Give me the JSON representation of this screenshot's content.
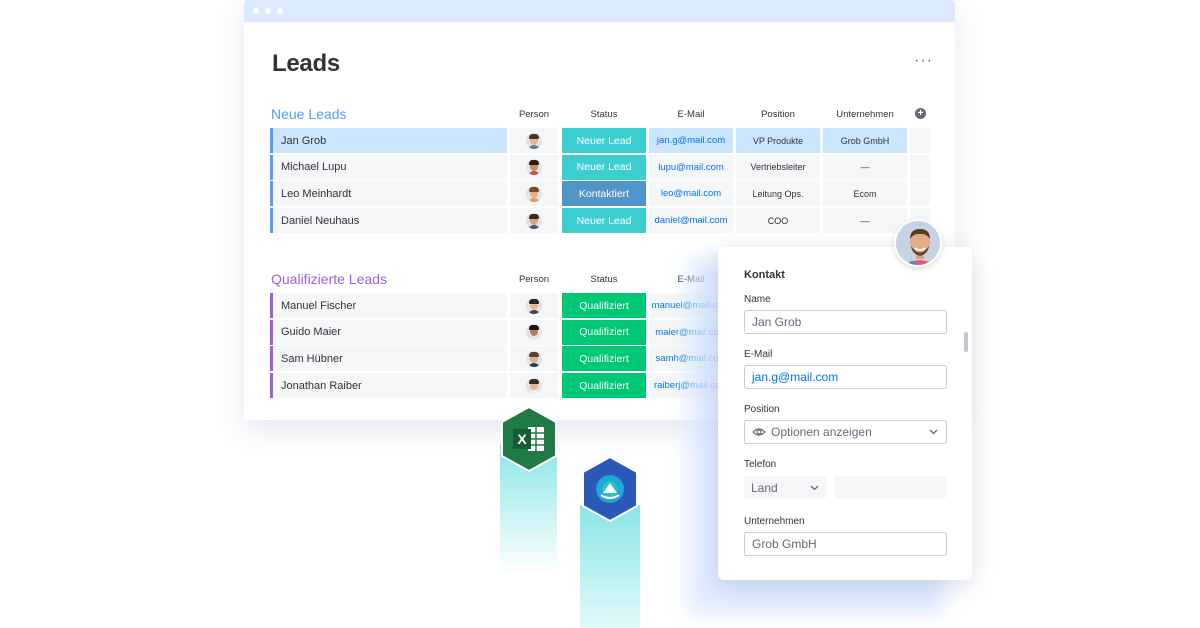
{
  "board": {
    "title": "Leads",
    "more_label": "···",
    "columns": {
      "person": "Person",
      "status": "Status",
      "email": "E-Mail",
      "position": "Position",
      "company": "Unternehmen"
    },
    "add_column_label": "+"
  },
  "groups": [
    {
      "title": "Neue Leads",
      "color": "#579bfc",
      "rows": [
        {
          "name": "Jan Grob",
          "status": "Neuer Lead",
          "status_color": "#3dcfcf",
          "email": "jan.g@mail.com",
          "position": "VP Produkte",
          "company": "Grob GmbH",
          "selected": true
        },
        {
          "name": "Michael Lupu",
          "status": "Neuer Lead",
          "status_color": "#3dcfcf",
          "email": "lupu@mail.com",
          "position": "Vertriebsleiter",
          "company": "—",
          "selected": false
        },
        {
          "name": "Leo Meinhardt",
          "status": "Kontaktiert",
          "status_color": "#5094c8",
          "email": "leo@mail.com",
          "position": "Leitung Ops.",
          "company": "Ecom",
          "selected": false
        },
        {
          "name": "Daniel Neuhaus",
          "status": "Neuer Lead",
          "status_color": "#3dcfcf",
          "email": "daniel@mail.com",
          "position": "COO",
          "company": "—",
          "selected": false
        }
      ]
    },
    {
      "title": "Qualifizierte Leads",
      "color": "#a25ddc",
      "rows": [
        {
          "name": "Manuel Fischer",
          "status": "Qualifiziert",
          "status_color": "#00c875",
          "email": "manuel@mail.com"
        },
        {
          "name": "Guido Maier",
          "status": "Qualifiziert",
          "status_color": "#00c875",
          "email": "maier@mail.com"
        },
        {
          "name": "Sam Hübner",
          "status": "Qualifiziert",
          "status_color": "#00c875",
          "email": "samh@mail.com"
        },
        {
          "name": "Jonathan Raiber",
          "status": "Qualifiziert",
          "status_color": "#00c875",
          "email": "raiberj@mail.com"
        }
      ]
    }
  ],
  "contact_card": {
    "title": "Kontakt",
    "name_label": "Name",
    "name_value": "Jan Grob",
    "email_label": "E-Mail",
    "email_value": "jan.g@mail.com",
    "position_label": "Position",
    "position_placeholder": "Optionen anzeigen",
    "phone_label": "Telefon",
    "country_placeholder": "Land",
    "company_label": "Unternehmen",
    "company_value": "Grob GmbH"
  },
  "integrations": {
    "excel_letter": "X",
    "excel_color": "#1f7a45",
    "app_color": "#2b59b8"
  },
  "icons": [
    "more-dots-icon",
    "add-column-icon",
    "eye-icon",
    "chevron-down-icon",
    "excel-icon",
    "integration-app-icon"
  ]
}
